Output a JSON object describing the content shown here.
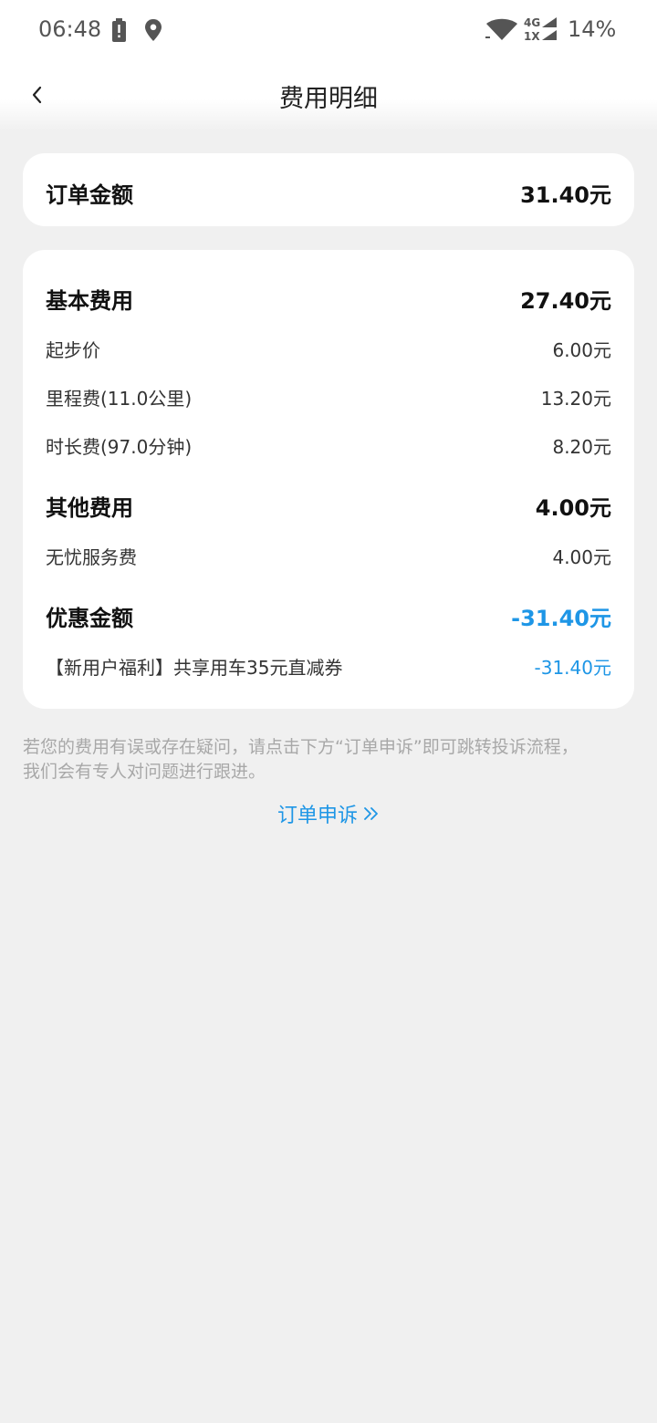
{
  "status_bar": {
    "time": "06:48",
    "network": "4G 1X",
    "battery": "14%"
  },
  "nav": {
    "title": "费用明细"
  },
  "summary": {
    "label": "订单金额",
    "value": "31.40元"
  },
  "basic": {
    "label": "基本费用",
    "value": "27.40元",
    "items": [
      {
        "label": "起步价",
        "value": "6.00元"
      },
      {
        "label": "里程费(11.0公里)",
        "value": "13.20元"
      },
      {
        "label": "时长费(97.0分钟)",
        "value": "8.20元"
      }
    ]
  },
  "other": {
    "label": "其他费用",
    "value": "4.00元",
    "items": [
      {
        "label": "无忧服务费",
        "value": "4.00元"
      }
    ]
  },
  "discount": {
    "label": "优惠金额",
    "value": "-31.40元",
    "items": [
      {
        "label": "【新用户福利】共享用车35元直减券",
        "value": "-31.40元"
      }
    ]
  },
  "note": {
    "line1": "若您的费用有误或存在疑问，请点击下方“订单申诉”即可跳转投诉流程，",
    "line2": "我们会有专人对问题进行跟进。"
  },
  "appeal": {
    "label": "订单申诉"
  },
  "colors": {
    "accent_blue": "#1e96e6",
    "background": "#f0f0f0",
    "card": "#ffffff"
  }
}
